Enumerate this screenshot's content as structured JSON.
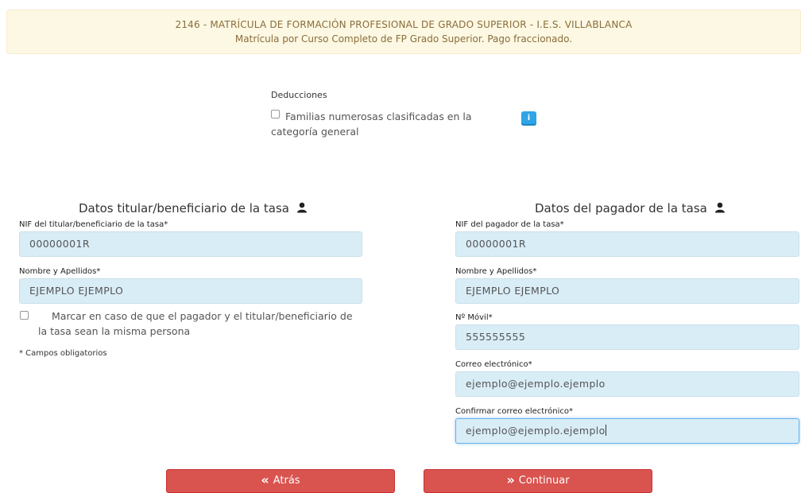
{
  "header": {
    "line1": "2146  -  MATRÍCULA DE FORMACIÓN PROFESIONAL DE GRADO SUPERIOR  -  I.E.S. VILLABLANCA",
    "line2": "Matrícula por Curso Completo de FP Grado Superior. Pago fraccionado."
  },
  "deductions": {
    "title": "Deducciones",
    "option_label": "Familias numerosas clasificadas en la categoría general",
    "info_icon": "i"
  },
  "titular": {
    "title": "Datos titular/beneficiario de la tasa",
    "nif_label": "NIF del titular/beneficiario de la tasa*",
    "nif_value": "00000001R",
    "name_label": "Nombre y Apellidos*",
    "name_value": "EJEMPLO EJEMPLO",
    "same_person_label": "Marcar en caso de que el pagador y el titular/beneficiario de la tasa sean la misma persona",
    "required_note": "* Campos obligatorios"
  },
  "pagador": {
    "title": "Datos del pagador de la tasa",
    "nif_label": "NIF del pagador de la tasa*",
    "nif_value": "00000001R",
    "name_label": "Nombre y Apellidos*",
    "name_value": "EJEMPLO EJEMPLO",
    "mobile_label": "Nº Móvil*",
    "mobile_value": "555555555",
    "email_label": "Correo electrónico*",
    "email_value": "ejemplo@ejemplo.ejemplo",
    "confirm_email_label": "Confirmar correo electrónico*",
    "confirm_email_value": "ejemplo@ejemplo.ejemplo"
  },
  "buttons": {
    "back_label": "Atrás",
    "continue_label": "Continuar",
    "back_icon": "«",
    "continue_icon": "»"
  },
  "colors": {
    "banner_bg": "#fcf8e3",
    "input_bg": "#d9edf7",
    "button_red": "#d9534f",
    "info_blue": "#2fa4e7"
  }
}
